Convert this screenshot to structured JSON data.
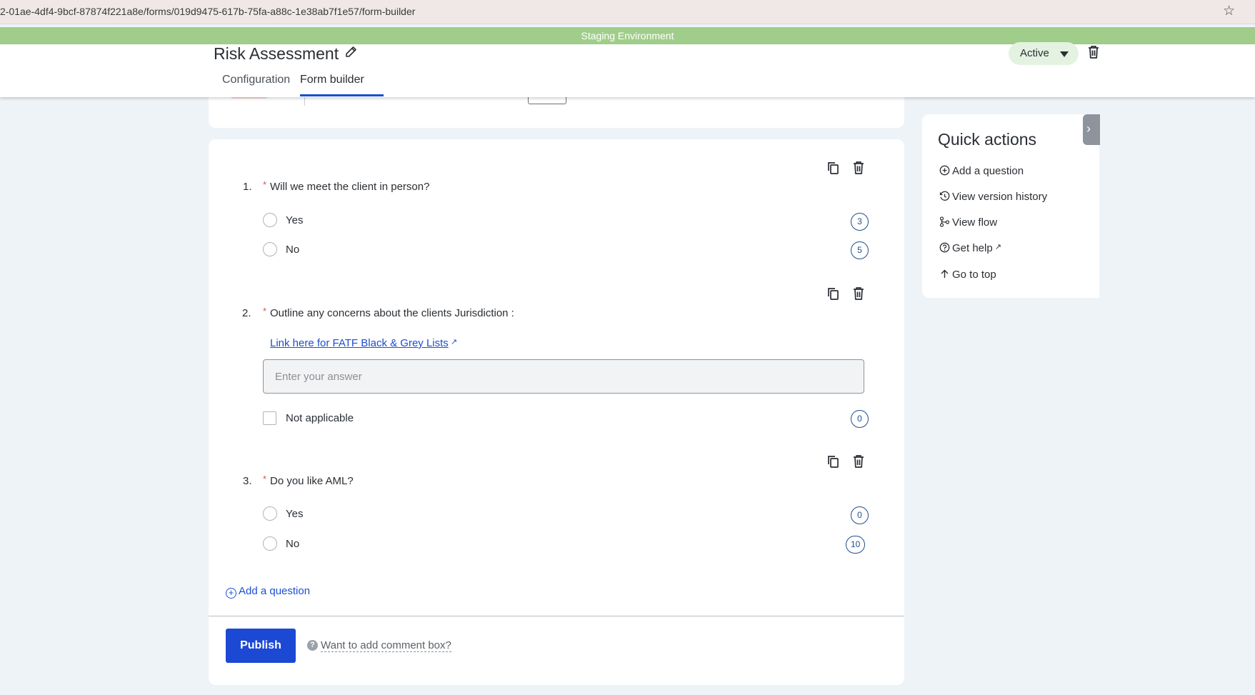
{
  "browser": {
    "url": "2-01ae-4df4-9bcf-87874f221a8e/forms/019d9475-617b-75fa-a88c-1e38ab7f1e57/form-builder",
    "bookmark_icon": "star-icon"
  },
  "banner": {
    "text": "Staging Environment",
    "color": "#a0ce8a"
  },
  "header": {
    "title": "Risk Assessment",
    "status": "Active",
    "tabs": [
      {
        "label": "Configuration",
        "active": false
      },
      {
        "label": "Form builder",
        "active": true
      }
    ]
  },
  "questions": [
    {
      "number": "1.",
      "required": "*",
      "text": "Will we meet the client in person?",
      "options": [
        {
          "label": "Yes",
          "score": "3"
        },
        {
          "label": "No",
          "score": "5"
        }
      ]
    },
    {
      "number": "2.",
      "required": "*",
      "text": "Outline any concerns about the clients Jurisdiction :",
      "link": "Link here for FATF Black & Grey Lists",
      "placeholder": "Enter your answer",
      "not_applicable": {
        "label": "Not applicable",
        "score": "0"
      }
    },
    {
      "number": "3.",
      "required": "*",
      "text": "Do you like AML?",
      "options": [
        {
          "label": "Yes",
          "score": "0"
        },
        {
          "label": "No",
          "score": "10"
        }
      ]
    }
  ],
  "form": {
    "add_question": "Add a question",
    "publish": "Publish",
    "comment_prompt": "Want to add comment box?"
  },
  "quick_actions": {
    "title": "Quick actions",
    "items": [
      {
        "label": "Add a question",
        "icon": "plus-circle-icon"
      },
      {
        "label": "View version history",
        "icon": "history-icon"
      },
      {
        "label": "View flow",
        "icon": "flow-icon"
      },
      {
        "label": "Get help",
        "icon": "help-circle-icon"
      },
      {
        "label": "Go to top",
        "icon": "arrow-up-icon"
      }
    ]
  },
  "colors": {
    "primary": "#1c49d4",
    "link": "#1a4fd1",
    "score_badge": "#1f4f8a",
    "required": "#d9534f",
    "status_bg": "#e3f2e1"
  }
}
